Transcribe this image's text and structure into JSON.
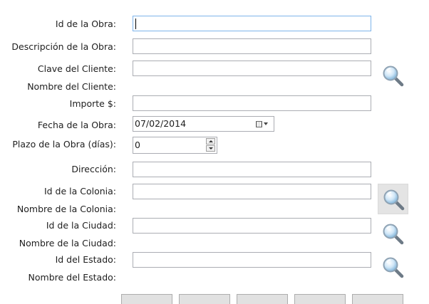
{
  "form": {
    "id_obra_label": "Id de la Obra:",
    "descripcion_label": "Descripción de la Obra:",
    "clave_cliente_label": "Clave del Cliente:",
    "nombre_cliente_label": "Nombre del Cliente:",
    "importe_label": "Importe $:",
    "fecha_label": "Fecha de la Obra:",
    "plazo_label": "Plazo de la Obra (días):",
    "direccion_label": "Dirección:",
    "id_colonia_label": "Id de la Colonia:",
    "nombre_colonia_label": "Nombre de la Colonia:",
    "id_ciudad_label": "Id de la Ciudad:",
    "nombre_ciudad_label": "Nombre de la Ciudad:",
    "id_estado_label": "Id del Estado:",
    "nombre_estado_label": "Nombre del Estado:"
  },
  "values": {
    "id_obra": "",
    "descripcion": "",
    "clave_cliente": "",
    "importe": "",
    "fecha": "07/02/2014",
    "plazo": "0",
    "direccion": "",
    "id_colonia": "",
    "id_ciudad": "",
    "id_estado": ""
  },
  "icons": {
    "search": "search-icon",
    "calendar": "calendar-icon",
    "dropdown": "chevron-down-icon"
  }
}
